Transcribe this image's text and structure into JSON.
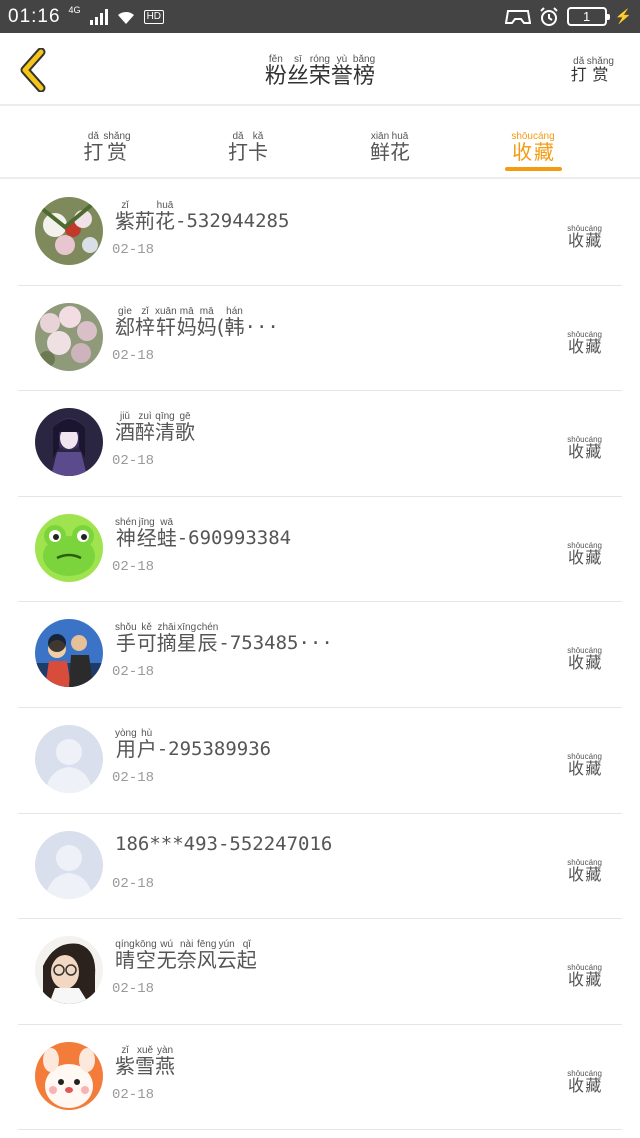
{
  "status_bar": {
    "time": "01:16",
    "network": "4G",
    "hd": "HD",
    "battery": "1",
    "icons": [
      "signal-icon",
      "wifi-icon",
      "gamepad-icon",
      "alarm-icon",
      "battery-icon",
      "charging-icon"
    ]
  },
  "header": {
    "back_icon": "chevron-left-icon",
    "title": [
      {
        "py": "fěn",
        "hz": "粉"
      },
      {
        "py": "sī",
        "hz": "丝"
      },
      {
        "py": "róng",
        "hz": "荣"
      },
      {
        "py": "yù",
        "hz": "誉"
      },
      {
        "py": "bǎng",
        "hz": "榜"
      }
    ],
    "right_action": [
      {
        "py": "dǎ",
        "hz": "打"
      },
      {
        "py": "shǎng",
        "hz": "赏"
      }
    ]
  },
  "tabs": [
    {
      "chars": [
        {
          "py": "dǎ",
          "hz": "打"
        },
        {
          "py": "shǎng",
          "hz": "赏"
        }
      ],
      "active": false
    },
    {
      "chars": [
        {
          "py": "dǎ",
          "hz": "打"
        },
        {
          "py": "kǎ",
          "hz": "卡"
        }
      ],
      "active": false
    },
    {
      "chars": [
        {
          "py": "xiān",
          "hz": "鲜"
        },
        {
          "py": "huā",
          "hz": "花"
        }
      ],
      "active": false
    },
    {
      "chars": [
        {
          "py": "shōu",
          "hz": "收"
        },
        {
          "py": "cáng",
          "hz": "藏"
        }
      ],
      "active": true
    }
  ],
  "list": [
    {
      "name": [
        {
          "py": "zǐ",
          "hz": "紫"
        },
        {
          "py": "",
          "hz": "荊"
        },
        {
          "py": "huā",
          "hz": "花"
        }
      ],
      "suffix": "-532944285",
      "date": "02-18",
      "avatar": "flowers"
    },
    {
      "name": [
        {
          "py": "gìe",
          "hz": "郄"
        },
        {
          "py": "zǐ",
          "hz": "梓"
        },
        {
          "py": "xuān",
          "hz": "轩"
        },
        {
          "py": "mā",
          "hz": "妈"
        },
        {
          "py": "mā",
          "hz": "妈"
        },
        {
          "py": "",
          "hz": " ("
        },
        {
          "py": "hán",
          "hz": "韩"
        }
      ],
      "suffix": "···",
      "date": "02-18",
      "avatar": "blossoms"
    },
    {
      "name": [
        {
          "py": "jiǔ",
          "hz": "酒"
        },
        {
          "py": "zuì",
          "hz": "醉"
        },
        {
          "py": "qīng",
          "hz": "清"
        },
        {
          "py": "gē",
          "hz": "歌"
        }
      ],
      "suffix": "",
      "date": "02-18",
      "avatar": "anime-girl"
    },
    {
      "name": [
        {
          "py": "shén",
          "hz": "神"
        },
        {
          "py": "jīng",
          "hz": "经"
        },
        {
          "py": "wā",
          "hz": "蛙"
        }
      ],
      "suffix": "-690993384",
      "date": "02-18",
      "avatar": "frog"
    },
    {
      "name": [
        {
          "py": "shǒu",
          "hz": "手"
        },
        {
          "py": "kě",
          "hz": "可"
        },
        {
          "py": "zhāi",
          "hz": "摘"
        },
        {
          "py": "xīng",
          "hz": "星"
        },
        {
          "py": "chén",
          "hz": "辰"
        }
      ],
      "suffix": "-753485···",
      "date": "02-18",
      "avatar": "group-photo"
    },
    {
      "name": [
        {
          "py": "yòng",
          "hz": "用"
        },
        {
          "py": "hù",
          "hz": "户"
        }
      ],
      "suffix": "-295389936",
      "date": "02-18",
      "avatar": "default"
    },
    {
      "name": [],
      "suffix": "186***493-552247016",
      "date": "02-18",
      "avatar": "default"
    },
    {
      "name": [
        {
          "py": "qíng",
          "hz": "晴"
        },
        {
          "py": "kōng",
          "hz": "空"
        },
        {
          "py": "wú",
          "hz": "无"
        },
        {
          "py": "nài",
          "hz": "奈"
        },
        {
          "py": "fēng",
          "hz": "风"
        },
        {
          "py": "yún",
          "hz": "云"
        },
        {
          "py": "qǐ",
          "hz": "起"
        }
      ],
      "suffix": "",
      "date": "02-18",
      "avatar": "girl-glasses"
    },
    {
      "name": [
        {
          "py": "zǐ",
          "hz": "紫"
        },
        {
          "py": "xuě",
          "hz": "雪"
        },
        {
          "py": "yàn",
          "hz": "燕"
        }
      ],
      "suffix": "",
      "date": "02-18",
      "avatar": "cartoon"
    }
  ],
  "row_action": [
    {
      "py": "shōu",
      "hz": "收"
    },
    {
      "py": "cáng",
      "hz": "藏"
    }
  ],
  "colors": {
    "status_bar": "#444444",
    "accent": "#f39c12",
    "back_icon_fill": "#f5c518",
    "divider": "#e6e6e6"
  }
}
